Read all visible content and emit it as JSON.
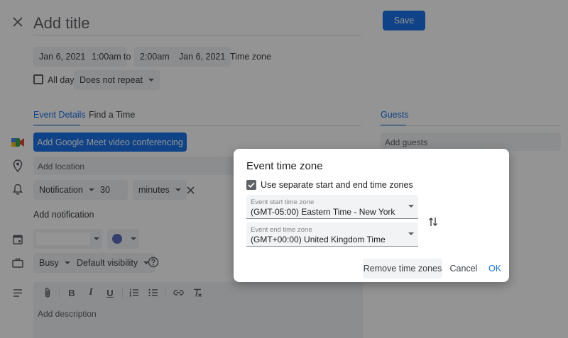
{
  "header": {
    "title_placeholder": "Add title",
    "save_label": "Save"
  },
  "datetime": {
    "start_date": "Jan 6, 2021",
    "start_time": "1:00am",
    "to_label": "to",
    "end_time": "2:00am",
    "end_date": "Jan 6, 2021",
    "timezone_label": "Time zone"
  },
  "allday": {
    "label": "All day",
    "repeat": "Does not repeat"
  },
  "tabs": {
    "event_details": "Event Details",
    "find_time": "Find a Time"
  },
  "guests": {
    "title": "Guests",
    "add_placeholder": "Add guests"
  },
  "meet": {
    "label": "Add Google Meet video conferencing"
  },
  "location": {
    "placeholder": "Add location"
  },
  "notification": {
    "type": "Notification",
    "value": "30",
    "unit": "minutes",
    "add_label": "Add notification"
  },
  "status": {
    "availability": "Busy",
    "visibility": "Default visibility"
  },
  "description": {
    "placeholder": "Add description"
  },
  "dialog": {
    "title": "Event time zone",
    "checkbox_label": "Use separate start and end time zones",
    "start_label": "Event start time zone",
    "start_value": "(GMT-05:00) Eastern Time - New York",
    "end_label": "Event end time zone",
    "end_value": "(GMT+00:00) United Kingdom Time",
    "remove_label": "Remove time zones",
    "cancel_label": "Cancel",
    "ok_label": "OK"
  },
  "colors": {
    "accent": "#1a73e8",
    "dim_overlay": "rgba(0,0,0,0.42)",
    "calendar_color": "#5c6bc0"
  }
}
